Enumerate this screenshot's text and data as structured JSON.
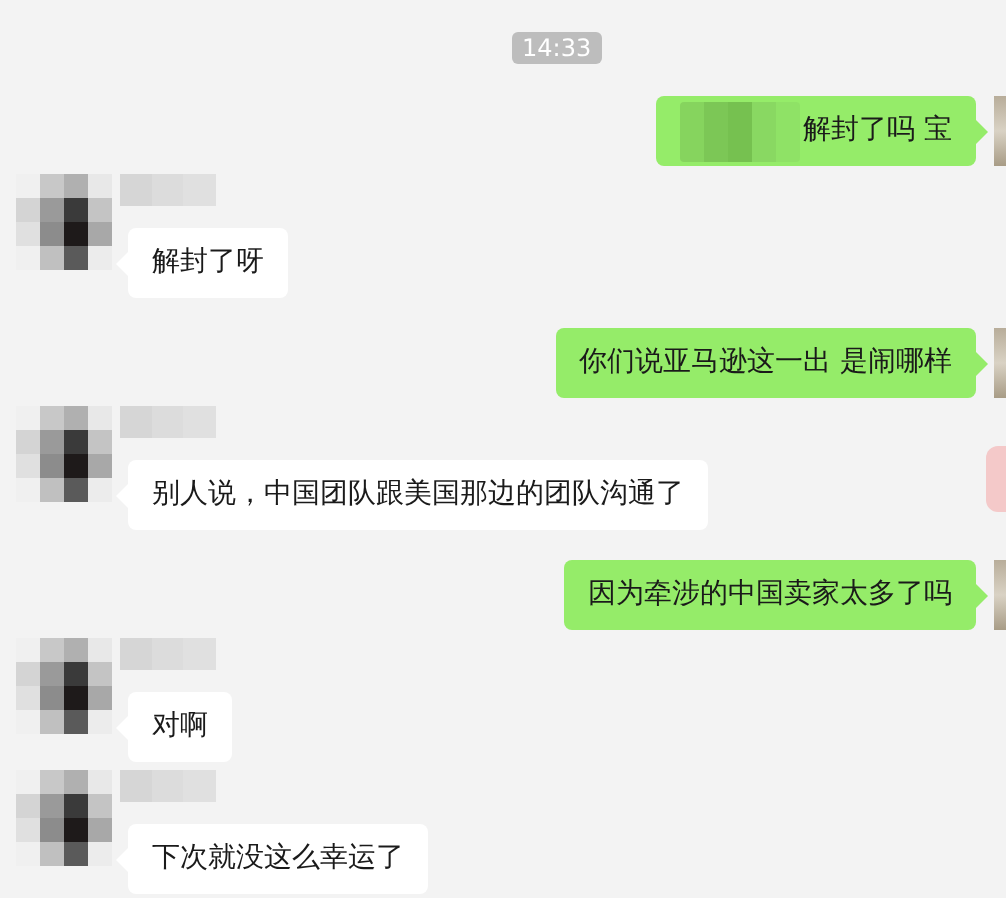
{
  "time_stamp": "14:33",
  "messages": [
    {
      "kind": "sent",
      "text": "解封了吗 宝",
      "redacted": true
    },
    {
      "kind": "received",
      "text": "解封了呀",
      "redacted": false
    },
    {
      "kind": "sent",
      "text": "你们说亚马逊这一出  是闹哪样",
      "redacted": false
    },
    {
      "kind": "received",
      "text": "别人说，中国团队跟美国那边的团队沟通了",
      "redacted": false
    },
    {
      "kind": "sent",
      "text": "因为牵涉的中国卖家太多了吗",
      "redacted": false
    },
    {
      "kind": "received",
      "text": "对啊",
      "redacted": false
    },
    {
      "kind": "received",
      "text": "下次就没这么幸运了",
      "redacted": false
    }
  ]
}
